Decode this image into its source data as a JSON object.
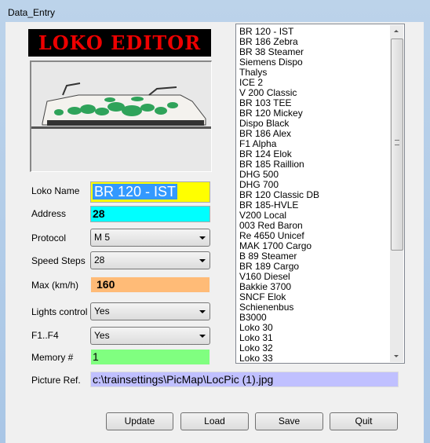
{
  "window": {
    "title": "Data_Entry"
  },
  "banner": {
    "text": "LOKO EDITOR",
    "color": "#e00000"
  },
  "form": {
    "loko_name": {
      "label": "Loko Name",
      "value": "BR 120 - IST",
      "bg": "#ffff00"
    },
    "address": {
      "label": "Address",
      "value": "28",
      "bg": "#00ffff"
    },
    "protocol": {
      "label": "Protocol",
      "value": "M 5"
    },
    "speed_steps": {
      "label": "Speed Steps",
      "value": "28"
    },
    "max_speed": {
      "label": "Max (km/h)",
      "value": "160",
      "bg": "#ffbb77"
    },
    "lights_control": {
      "label": "Lights control",
      "value": "Yes"
    },
    "f1_f4": {
      "label": "F1..F4",
      "value": "Yes"
    },
    "memory": {
      "label": "Memory #",
      "value": "1",
      "bg": "#80ff80"
    },
    "picture_ref": {
      "label": "Picture Ref.",
      "value": "c:\\trainsettings\\PicMap\\LocPic (1).jpg",
      "bg": "#c0c0ff"
    }
  },
  "loko_list": [
    "BR 120 - IST",
    "BR 186 Zebra",
    "BR 38 Steamer",
    "Siemens Dispo",
    "Thalys",
    "ICE 2",
    "V 200 Classic",
    "BR 103 TEE",
    "BR 120 Mickey",
    "Dispo Black",
    "BR 186 Alex",
    "F1 Alpha",
    "BR 124 Elok",
    "BR 185 Raillion",
    "DHG 500",
    "DHG 700",
    "BR 120 Classic DB",
    "BR 185-HVLE",
    "V200 Local",
    "003 Red Baron",
    "Re 4650 Unicef",
    "MAK 1700 Cargo",
    "B 89 Steamer",
    "BR 189 Cargo",
    "V160 Diesel",
    "Bakkie 3700",
    "SNCF Elok",
    "Schienenbus",
    "B3000",
    "Loko  30",
    "Loko  31",
    "Loko  32",
    "Loko  33"
  ],
  "buttons": {
    "update": "Update",
    "load": "Load",
    "save": "Save",
    "quit": "Quit"
  }
}
